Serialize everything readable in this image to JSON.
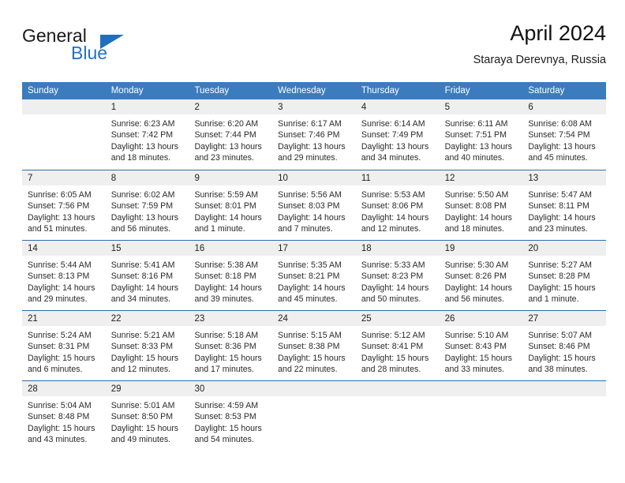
{
  "brand": {
    "name_part1": "General",
    "name_part2": "Blue",
    "logo_icon": "triangle-logo-icon",
    "accent_color": "#2272bd"
  },
  "header": {
    "title": "April 2024",
    "subtitle": "Staraya Derevnya, Russia"
  },
  "colors": {
    "header_bar": "#3b7cbe",
    "week_divider": "#2e6da8",
    "daynum_band": "#efefef"
  },
  "weekday_headers": [
    "Sunday",
    "Monday",
    "Tuesday",
    "Wednesday",
    "Thursday",
    "Friday",
    "Saturday"
  ],
  "weeks": [
    [
      {
        "day": "",
        "empty": true,
        "l1": "",
        "l2": "",
        "l3": "",
        "l4": ""
      },
      {
        "day": "1",
        "l1": "Sunrise: 6:23 AM",
        "l2": "Sunset: 7:42 PM",
        "l3": "Daylight: 13 hours",
        "l4": "and 18 minutes."
      },
      {
        "day": "2",
        "l1": "Sunrise: 6:20 AM",
        "l2": "Sunset: 7:44 PM",
        "l3": "Daylight: 13 hours",
        "l4": "and 23 minutes."
      },
      {
        "day": "3",
        "l1": "Sunrise: 6:17 AM",
        "l2": "Sunset: 7:46 PM",
        "l3": "Daylight: 13 hours",
        "l4": "and 29 minutes."
      },
      {
        "day": "4",
        "l1": "Sunrise: 6:14 AM",
        "l2": "Sunset: 7:49 PM",
        "l3": "Daylight: 13 hours",
        "l4": "and 34 minutes."
      },
      {
        "day": "5",
        "l1": "Sunrise: 6:11 AM",
        "l2": "Sunset: 7:51 PM",
        "l3": "Daylight: 13 hours",
        "l4": "and 40 minutes."
      },
      {
        "day": "6",
        "l1": "Sunrise: 6:08 AM",
        "l2": "Sunset: 7:54 PM",
        "l3": "Daylight: 13 hours",
        "l4": "and 45 minutes."
      }
    ],
    [
      {
        "day": "7",
        "l1": "Sunrise: 6:05 AM",
        "l2": "Sunset: 7:56 PM",
        "l3": "Daylight: 13 hours",
        "l4": "and 51 minutes."
      },
      {
        "day": "8",
        "l1": "Sunrise: 6:02 AM",
        "l2": "Sunset: 7:59 PM",
        "l3": "Daylight: 13 hours",
        "l4": "and 56 minutes."
      },
      {
        "day": "9",
        "l1": "Sunrise: 5:59 AM",
        "l2": "Sunset: 8:01 PM",
        "l3": "Daylight: 14 hours",
        "l4": "and 1 minute."
      },
      {
        "day": "10",
        "l1": "Sunrise: 5:56 AM",
        "l2": "Sunset: 8:03 PM",
        "l3": "Daylight: 14 hours",
        "l4": "and 7 minutes."
      },
      {
        "day": "11",
        "l1": "Sunrise: 5:53 AM",
        "l2": "Sunset: 8:06 PM",
        "l3": "Daylight: 14 hours",
        "l4": "and 12 minutes."
      },
      {
        "day": "12",
        "l1": "Sunrise: 5:50 AM",
        "l2": "Sunset: 8:08 PM",
        "l3": "Daylight: 14 hours",
        "l4": "and 18 minutes."
      },
      {
        "day": "13",
        "l1": "Sunrise: 5:47 AM",
        "l2": "Sunset: 8:11 PM",
        "l3": "Daylight: 14 hours",
        "l4": "and 23 minutes."
      }
    ],
    [
      {
        "day": "14",
        "l1": "Sunrise: 5:44 AM",
        "l2": "Sunset: 8:13 PM",
        "l3": "Daylight: 14 hours",
        "l4": "and 29 minutes."
      },
      {
        "day": "15",
        "l1": "Sunrise: 5:41 AM",
        "l2": "Sunset: 8:16 PM",
        "l3": "Daylight: 14 hours",
        "l4": "and 34 minutes."
      },
      {
        "day": "16",
        "l1": "Sunrise: 5:38 AM",
        "l2": "Sunset: 8:18 PM",
        "l3": "Daylight: 14 hours",
        "l4": "and 39 minutes."
      },
      {
        "day": "17",
        "l1": "Sunrise: 5:35 AM",
        "l2": "Sunset: 8:21 PM",
        "l3": "Daylight: 14 hours",
        "l4": "and 45 minutes."
      },
      {
        "day": "18",
        "l1": "Sunrise: 5:33 AM",
        "l2": "Sunset: 8:23 PM",
        "l3": "Daylight: 14 hours",
        "l4": "and 50 minutes."
      },
      {
        "day": "19",
        "l1": "Sunrise: 5:30 AM",
        "l2": "Sunset: 8:26 PM",
        "l3": "Daylight: 14 hours",
        "l4": "and 56 minutes."
      },
      {
        "day": "20",
        "l1": "Sunrise: 5:27 AM",
        "l2": "Sunset: 8:28 PM",
        "l3": "Daylight: 15 hours",
        "l4": "and 1 minute."
      }
    ],
    [
      {
        "day": "21",
        "l1": "Sunrise: 5:24 AM",
        "l2": "Sunset: 8:31 PM",
        "l3": "Daylight: 15 hours",
        "l4": "and 6 minutes."
      },
      {
        "day": "22",
        "l1": "Sunrise: 5:21 AM",
        "l2": "Sunset: 8:33 PM",
        "l3": "Daylight: 15 hours",
        "l4": "and 12 minutes."
      },
      {
        "day": "23",
        "l1": "Sunrise: 5:18 AM",
        "l2": "Sunset: 8:36 PM",
        "l3": "Daylight: 15 hours",
        "l4": "and 17 minutes."
      },
      {
        "day": "24",
        "l1": "Sunrise: 5:15 AM",
        "l2": "Sunset: 8:38 PM",
        "l3": "Daylight: 15 hours",
        "l4": "and 22 minutes."
      },
      {
        "day": "25",
        "l1": "Sunrise: 5:12 AM",
        "l2": "Sunset: 8:41 PM",
        "l3": "Daylight: 15 hours",
        "l4": "and 28 minutes."
      },
      {
        "day": "26",
        "l1": "Sunrise: 5:10 AM",
        "l2": "Sunset: 8:43 PM",
        "l3": "Daylight: 15 hours",
        "l4": "and 33 minutes."
      },
      {
        "day": "27",
        "l1": "Sunrise: 5:07 AM",
        "l2": "Sunset: 8:46 PM",
        "l3": "Daylight: 15 hours",
        "l4": "and 38 minutes."
      }
    ],
    [
      {
        "day": "28",
        "l1": "Sunrise: 5:04 AM",
        "l2": "Sunset: 8:48 PM",
        "l3": "Daylight: 15 hours",
        "l4": "and 43 minutes."
      },
      {
        "day": "29",
        "l1": "Sunrise: 5:01 AM",
        "l2": "Sunset: 8:50 PM",
        "l3": "Daylight: 15 hours",
        "l4": "and 49 minutes."
      },
      {
        "day": "30",
        "l1": "Sunrise: 4:59 AM",
        "l2": "Sunset: 8:53 PM",
        "l3": "Daylight: 15 hours",
        "l4": "and 54 minutes."
      },
      {
        "day": "",
        "empty": true,
        "l1": "",
        "l2": "",
        "l3": "",
        "l4": ""
      },
      {
        "day": "",
        "empty": true,
        "l1": "",
        "l2": "",
        "l3": "",
        "l4": ""
      },
      {
        "day": "",
        "empty": true,
        "l1": "",
        "l2": "",
        "l3": "",
        "l4": ""
      },
      {
        "day": "",
        "empty": true,
        "l1": "",
        "l2": "",
        "l3": "",
        "l4": ""
      }
    ]
  ]
}
